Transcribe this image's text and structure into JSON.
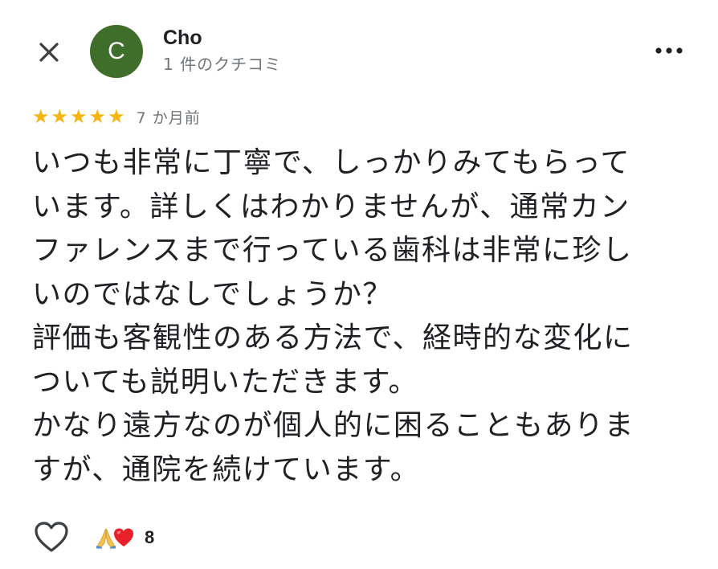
{
  "reviewer": {
    "avatar_initial": "C",
    "name": "Cho",
    "review_count": "1 件のクチコミ"
  },
  "review": {
    "rating": 5,
    "stars": [
      "★",
      "★",
      "★",
      "★",
      "★"
    ],
    "date": "7 か月前",
    "text": "いつも非常に丁寧で、しっかりみてもらって\nいます。詳しくはわかりませんが、通常カン\nファレンスまで行っている歯科は非常に珍し\nいのではなしでしょうか？\n評価も客観性のある方法で、経時的な変化に\nついても説明いただきます。\nかなり遠方なのが個人的に困ることもありま\nすが、通院を続けています。"
  },
  "reactions": {
    "icons": [
      "folded-hands-icon",
      "red-heart-icon"
    ],
    "count": "8"
  },
  "icons": {
    "close": "close-icon",
    "more": "more-vert-icon",
    "like": "heart-outline-icon"
  },
  "colors": {
    "avatar_bg": "#3f6e2a",
    "star": "#f6b40e",
    "secondary_text": "#70757a",
    "primary_text": "#202124"
  }
}
